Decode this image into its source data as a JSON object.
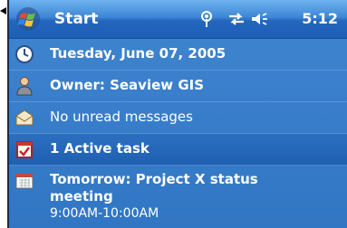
{
  "titlebar": {
    "title": "Start",
    "time": "5:12",
    "icons": [
      "windows-flag-icon",
      "antenna-icon",
      "connectivity-icon",
      "speaker-icon"
    ]
  },
  "today": {
    "date": "Tuesday, June 07, 2005",
    "owner": "Owner: Seaview GIS",
    "messages": "No unread messages",
    "tasks": "1 Active task",
    "appointment": {
      "title": "Tomorrow: Project X status meeting",
      "time": "9:00AM-10:00AM"
    }
  },
  "colors": {
    "background": "#3a7fcb",
    "titlebar": "#2466bd",
    "text": "#ffffff"
  }
}
